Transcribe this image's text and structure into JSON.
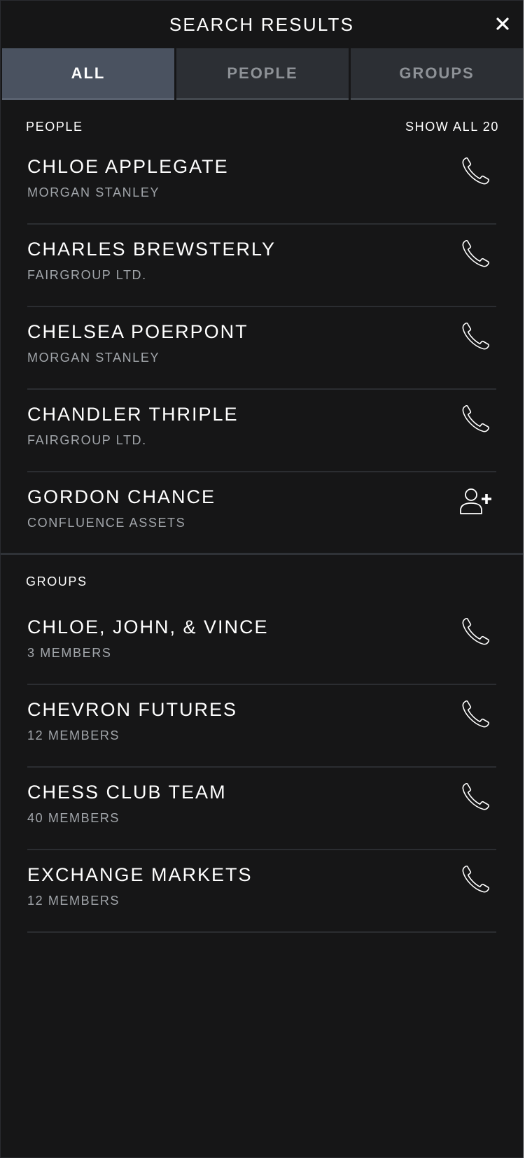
{
  "header": {
    "title": "SEARCH RESULTS",
    "close_icon": "close-icon"
  },
  "tabs": [
    {
      "label": "ALL",
      "active": true
    },
    {
      "label": "PEOPLE",
      "active": false
    },
    {
      "label": "GROUPS",
      "active": false
    }
  ],
  "people": {
    "heading": "PEOPLE",
    "show_all": "SHOW ALL 20",
    "items": [
      {
        "name": "CHLOE APPLEGATE",
        "company": "MORGAN STANLEY",
        "action_icon": "phone-icon"
      },
      {
        "name": "CHARLES BREWSTERLY",
        "company": "FAIRGROUP LTD.",
        "action_icon": "phone-icon"
      },
      {
        "name": "CHELSEA POERPONT",
        "company": "MORGAN STANLEY",
        "action_icon": "phone-icon"
      },
      {
        "name": "CHANDLER THRIPLE",
        "company": "FAIRGROUP LTD.",
        "action_icon": "phone-icon"
      },
      {
        "name": "GORDON CHANCE",
        "company": "CONFLUENCE ASSETS",
        "action_icon": "add-contact-icon"
      }
    ]
  },
  "groups": {
    "heading": "GROUPS",
    "items": [
      {
        "name": "CHLOE, JOHN, & VINCE",
        "members": "3 MEMBERS",
        "action_icon": "phone-icon"
      },
      {
        "name": "CHEVRON FUTURES",
        "members": "12 MEMBERS",
        "action_icon": "phone-icon"
      },
      {
        "name": "CHESS CLUB TEAM",
        "members": "40 MEMBERS",
        "action_icon": "phone-icon"
      },
      {
        "name": "EXCHANGE MARKETS",
        "members": "12 MEMBERS",
        "action_icon": "phone-icon"
      }
    ]
  },
  "colors": {
    "background": "#161617",
    "tab_active": "#4a5260",
    "tab_inactive": "#2c2f34",
    "divider": "#2b2d31",
    "secondary_text": "#a2a6ab"
  }
}
